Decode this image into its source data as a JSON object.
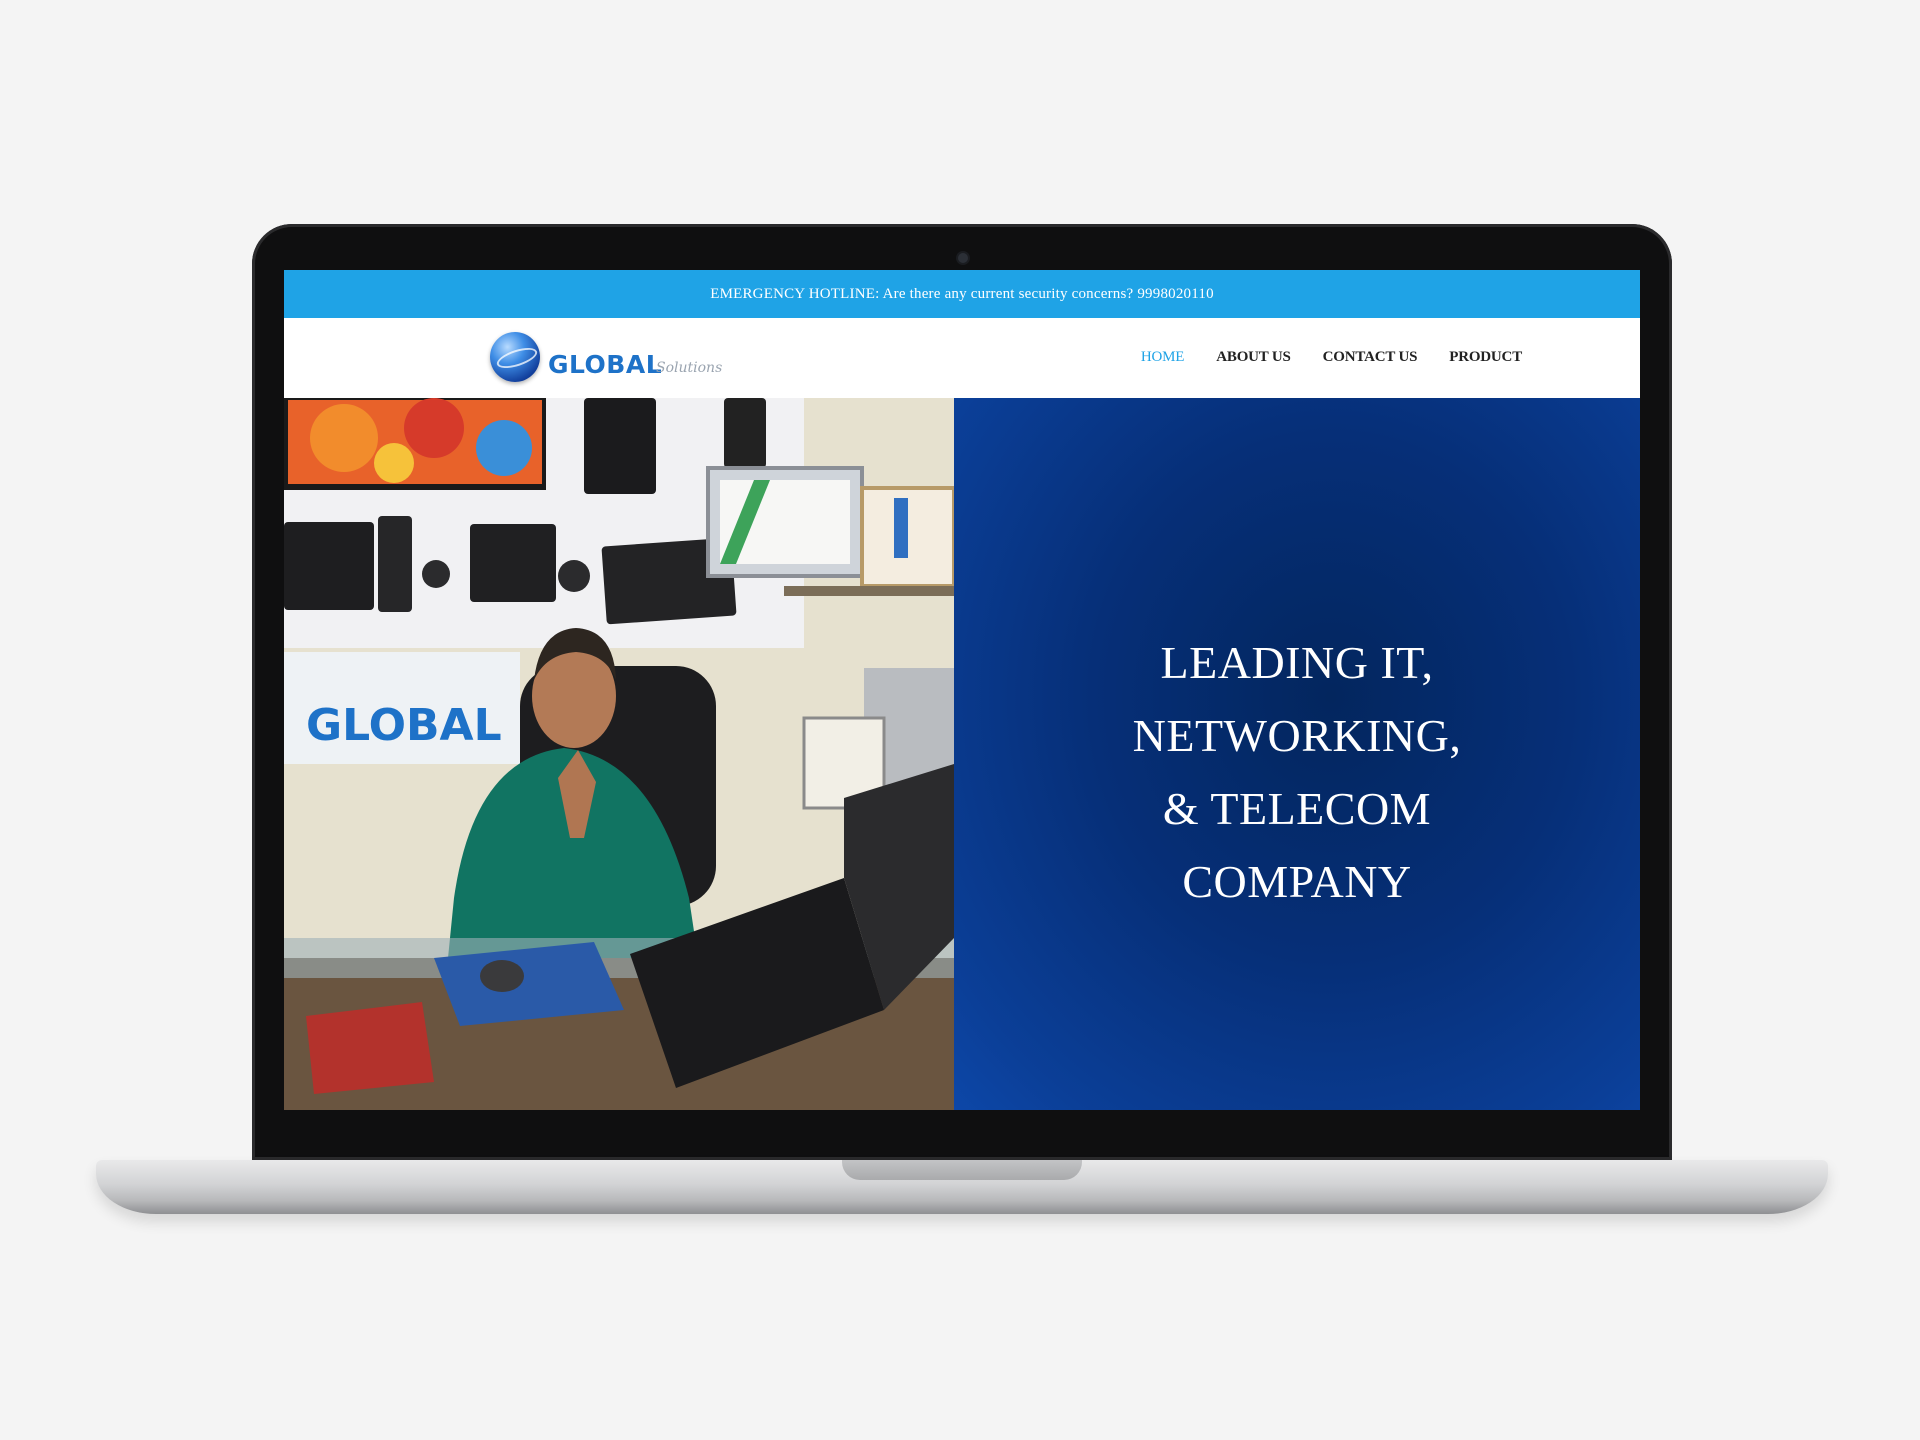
{
  "site": {
    "hotline": "EMERGENCY HOTLINE: Are there any current security concerns? 9998020110",
    "logo": {
      "name": "GLOBAL",
      "sub": "Solutions"
    },
    "nav": [
      {
        "label": "HOME",
        "active": true
      },
      {
        "label": "ABOUT US",
        "active": false
      },
      {
        "label": "CONTACT US",
        "active": false
      },
      {
        "label": "PRODUCT",
        "active": false
      }
    ],
    "hero": {
      "lines": [
        "LEADING IT,",
        "NETWORKING,",
        "& TELECOM",
        "COMPANY"
      ],
      "photo_sign": "GLOBAL"
    }
  },
  "colors": {
    "hotline_bar": "#1fa3e6",
    "nav_active": "#1fa3e6",
    "hero_panel": "#0b3f98",
    "page_bg": "#f4f4f4"
  }
}
